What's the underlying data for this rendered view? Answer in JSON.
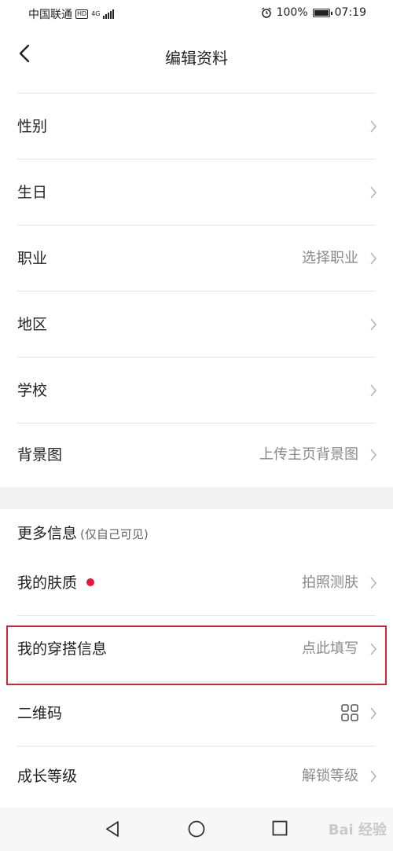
{
  "status_bar": {
    "carrier": "中国联通",
    "hd": "HD",
    "network": "4G",
    "battery": "100%",
    "battery_level": 1.0,
    "time": "07:19"
  },
  "header": {
    "title": "编辑资料"
  },
  "rows": [
    {
      "label": "性别",
      "value": ""
    },
    {
      "label": "生日",
      "value": ""
    },
    {
      "label": "职业",
      "value": "选择职业"
    },
    {
      "label": "地区",
      "value": ""
    },
    {
      "label": "学校",
      "value": ""
    },
    {
      "label": "背景图",
      "value": "上传主页背景图"
    }
  ],
  "more_section": {
    "title": "更多信息",
    "subtitle": "(仅自己可见)",
    "rows": [
      {
        "label": "我的肤质",
        "value": "拍照测肤",
        "dot_color": "#e6173d"
      },
      {
        "label": "我的穿搭信息",
        "value": "点此填写"
      },
      {
        "label": "二维码",
        "value": "",
        "icon": "qr-grid-icon"
      },
      {
        "label": "成长等级",
        "value": "解锁等级"
      }
    ]
  },
  "nav": {
    "watermark": "Bai 经验"
  },
  "colors": {
    "highlight": "#d0263a",
    "accent": "#e6173d"
  }
}
